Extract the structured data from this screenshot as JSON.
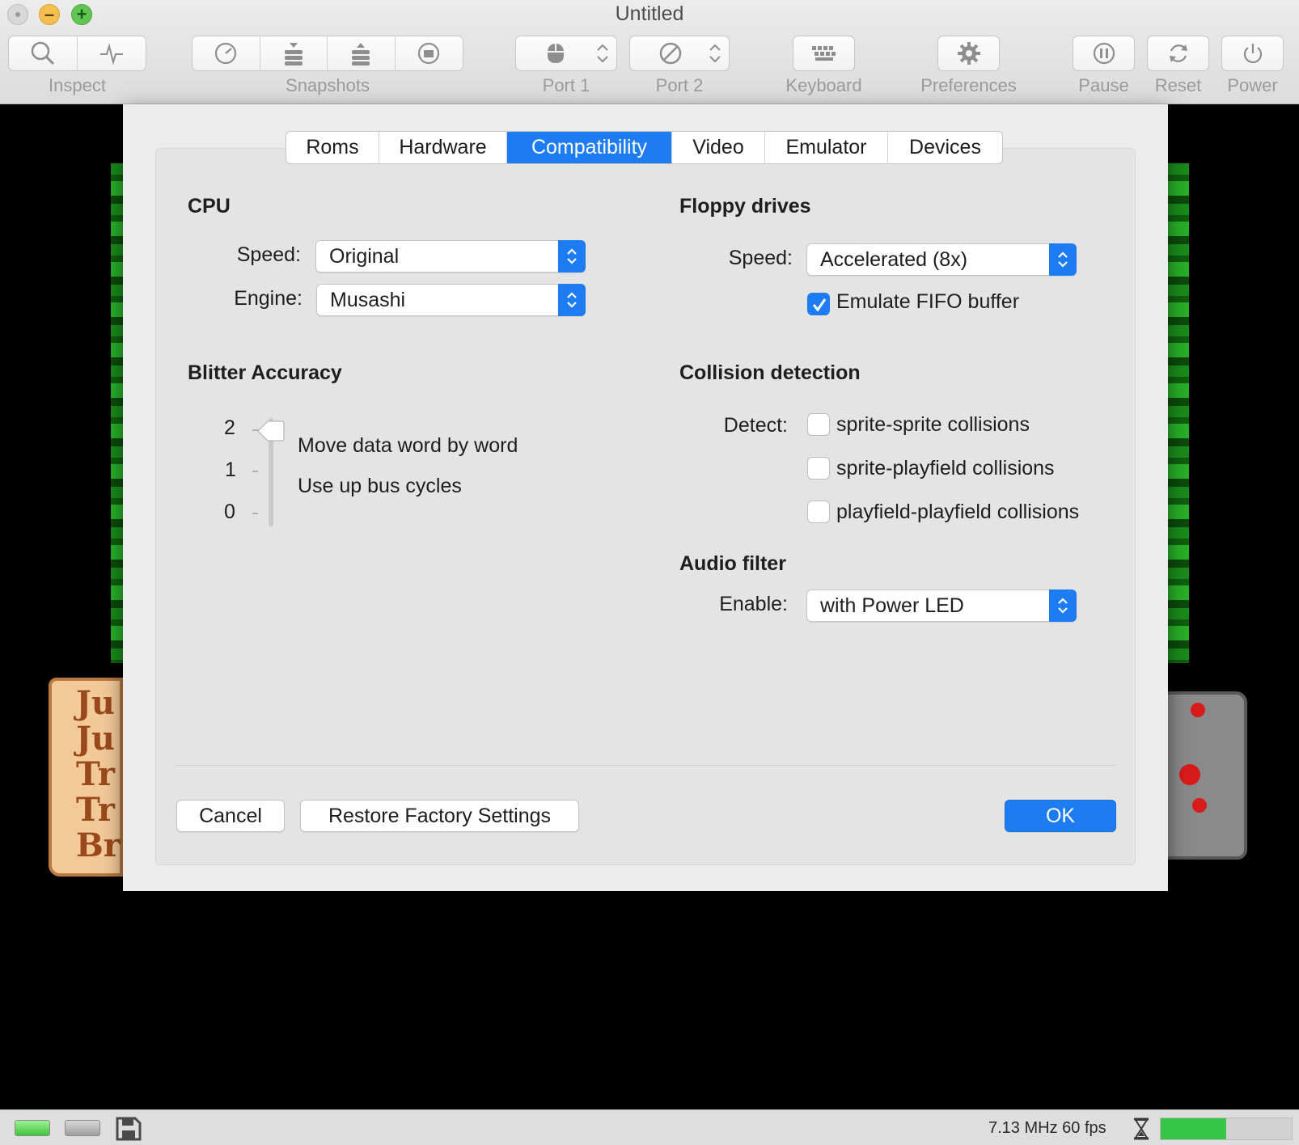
{
  "window": {
    "title": "Untitled"
  },
  "toolbar": {
    "inspect": {
      "label": "Inspect",
      "icons": [
        "magnifier-icon",
        "activity-icon"
      ]
    },
    "snapshots": {
      "label": "Snapshots",
      "icons": [
        "clock-icon",
        "stack-down-icon",
        "stack-up-icon",
        "restore-icon"
      ]
    },
    "port1": {
      "label": "Port 1",
      "icon": "mouse-icon"
    },
    "port2": {
      "label": "Port 2",
      "icon": "none-icon"
    },
    "keyboard": {
      "label": "Keyboard",
      "icon": "keyboard-icon"
    },
    "preferences": {
      "label": "Preferences",
      "icon": "gear-icon"
    },
    "pause": {
      "label": "Pause",
      "icon": "pause-icon"
    },
    "reset": {
      "label": "Reset",
      "icon": "reset-icon"
    },
    "power": {
      "label": "Power",
      "icon": "power-icon"
    }
  },
  "tabs": [
    {
      "label": "Roms",
      "active": false
    },
    {
      "label": "Hardware",
      "active": false
    },
    {
      "label": "Compatibility",
      "active": true
    },
    {
      "label": "Video",
      "active": false
    },
    {
      "label": "Emulator",
      "active": false
    },
    {
      "label": "Devices",
      "active": false
    }
  ],
  "cpu": {
    "title": "CPU",
    "speed_label": "Speed:",
    "speed_value": "Original",
    "engine_label": "Engine:",
    "engine_value": "Musashi"
  },
  "floppy": {
    "title": "Floppy drives",
    "speed_label": "Speed:",
    "speed_value": "Accelerated (8x)",
    "fifo_label": "Emulate FIFO buffer",
    "fifo_checked": true
  },
  "blitter": {
    "title": "Blitter Accuracy",
    "levels": [
      "2",
      "1",
      "0"
    ],
    "value": 2,
    "desc_line1": "Move data word by word",
    "desc_line2": "Use up bus cycles"
  },
  "collision": {
    "title": "Collision detection",
    "detect_label": "Detect:",
    "options": [
      {
        "label": "sprite-sprite collisions",
        "checked": false
      },
      {
        "label": "sprite-playfield collisions",
        "checked": false
      },
      {
        "label": "playfield-playfield collisions",
        "checked": false
      }
    ]
  },
  "audio": {
    "title": "Audio filter",
    "enable_label": "Enable:",
    "enable_value": "with Power LED"
  },
  "buttons": {
    "cancel": "Cancel",
    "restore": "Restore Factory Settings",
    "ok": "OK"
  },
  "status": {
    "speed_text": "7.13 MHz 60 fps",
    "perf_fraction": 0.5
  },
  "colors": {
    "accent": "#1e7cf2",
    "perf": "#36c546"
  }
}
